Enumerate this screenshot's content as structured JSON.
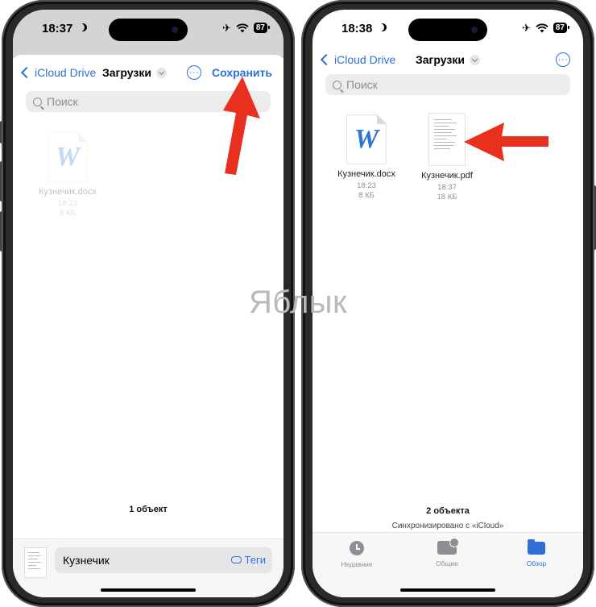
{
  "left": {
    "status": {
      "time": "18:37",
      "battery": "87"
    },
    "nav": {
      "back_label": "iCloud Drive",
      "folder": "Загрузки",
      "save_label": "Сохранить"
    },
    "search": {
      "placeholder": "Поиск"
    },
    "files": [
      {
        "name": "Кузнечик.docx",
        "time": "18:23",
        "size": "8 КБ",
        "icon": "word-doc-icon"
      }
    ],
    "count": "1 объект",
    "save_bar": {
      "filename": "Кузнечик",
      "tags_label": "Теги"
    }
  },
  "right": {
    "status": {
      "time": "18:38",
      "battery": "87"
    },
    "nav": {
      "back_label": "iCloud Drive",
      "folder": "Загрузки"
    },
    "search": {
      "placeholder": "Поиск"
    },
    "files": [
      {
        "name": "Кузнечик.docx",
        "time": "18:23",
        "size": "8 КБ",
        "icon": "word-doc-icon"
      },
      {
        "name": "Кузнечик.pdf",
        "time": "18:37",
        "size": "18 КБ",
        "icon": "pdf-doc-icon"
      }
    ],
    "count": "2 объекта",
    "sync": "Синхронизировано с «iCloud»",
    "tabs": [
      {
        "label": "Недавние",
        "icon": "clock-icon",
        "active": false
      },
      {
        "label": "Общие",
        "icon": "shared-folder-icon",
        "active": false
      },
      {
        "label": "Обзор",
        "icon": "folder-icon",
        "active": true
      }
    ]
  },
  "watermark": "Яблык",
  "colors": {
    "accent": "#2f6fd6",
    "arrow": "#e8301f",
    "word_blue": "#2d77d2"
  }
}
